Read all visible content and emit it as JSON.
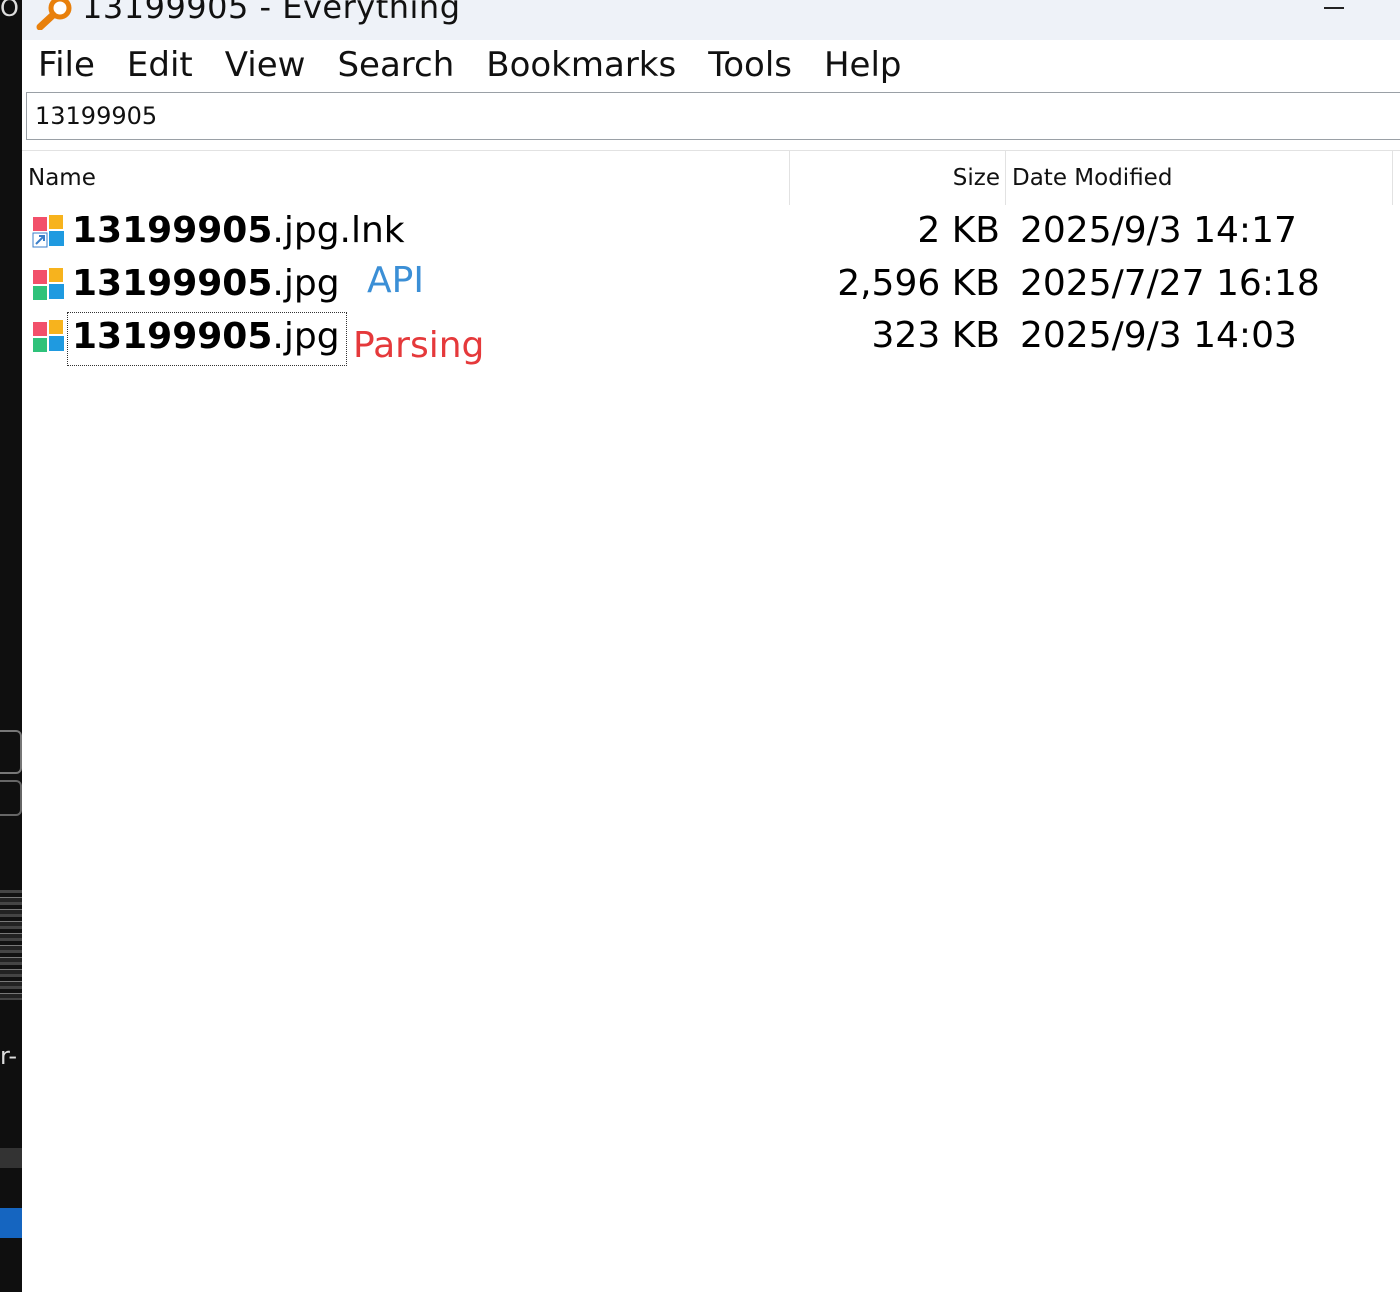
{
  "desktop": {
    "edge_text_top": "O",
    "edge_text_bottom": "r-"
  },
  "window": {
    "title": "13199905 - Everything",
    "app_icon": "magnifier-icon"
  },
  "menu": [
    "File",
    "Edit",
    "View",
    "Search",
    "Bookmarks",
    "Tools",
    "Help"
  ],
  "search": {
    "value": "13199905"
  },
  "columns": {
    "name": "Name",
    "size": "Size",
    "date": "Date Modified"
  },
  "rows": [
    {
      "name_bold": "13199905",
      "name_rest": ".jpg.lnk",
      "size": "2 KB",
      "date": "2025/9/3 14:17",
      "icon": "shortcut-image-file-icon"
    },
    {
      "name_bold": "13199905",
      "name_rest": ".jpg",
      "size": "2,596 KB",
      "date": "2025/7/27 16:18",
      "icon": "image-file-icon"
    },
    {
      "name_bold": "13199905",
      "name_rest": ".jpg",
      "size": "323 KB",
      "date": "2025/9/3 14:03",
      "icon": "image-file-icon"
    }
  ],
  "annotations": [
    {
      "text": "API",
      "color": "#3b8fd6"
    },
    {
      "text": "Parsing",
      "color": "#e5393b"
    }
  ]
}
